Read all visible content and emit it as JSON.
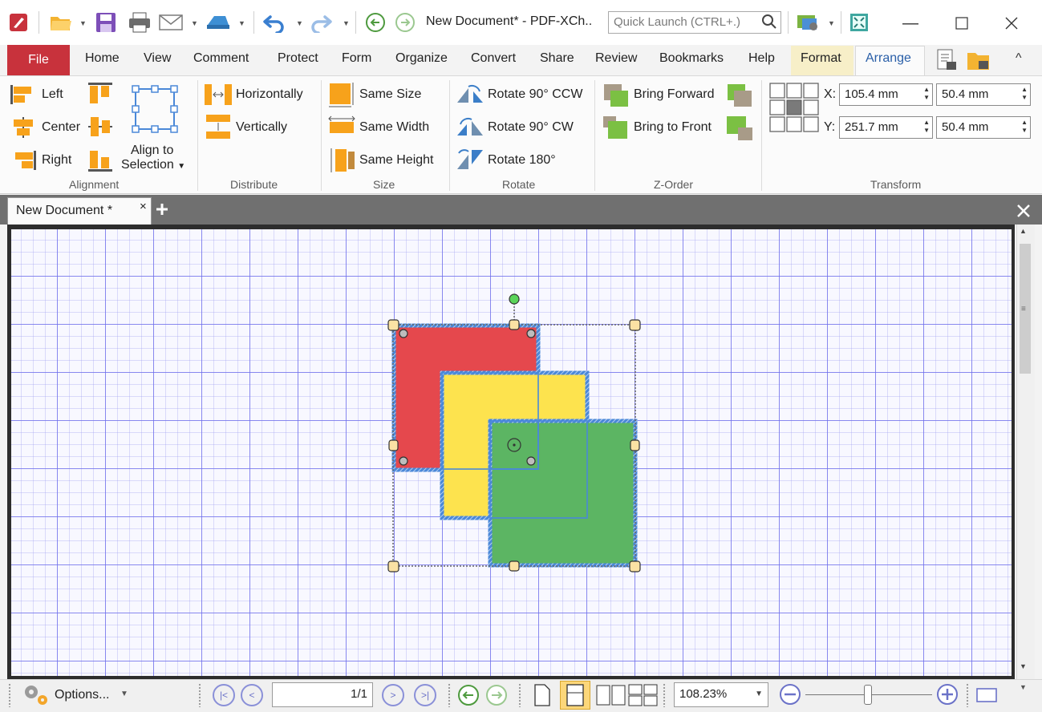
{
  "window": {
    "title": "New Document* - PDF-XCh..",
    "quick_launch_placeholder": "Quick Launch (CTRL+.)"
  },
  "menu": {
    "tabs": [
      "File",
      "Home",
      "View",
      "Comment",
      "Protect",
      "Form",
      "Organize",
      "Convert",
      "Share",
      "Review",
      "Bookmarks",
      "Help",
      "Format",
      "Arrange"
    ],
    "active_tab": "Arrange",
    "contextual_tab": "Format"
  },
  "ribbon": {
    "alignment": {
      "label": "Alignment",
      "left": "Left",
      "center": "Center",
      "right": "Right",
      "align_to_line1": "Align to",
      "align_to_line2": "Selection"
    },
    "distribute": {
      "label": "Distribute",
      "horizontally": "Horizontally",
      "vertically": "Vertically"
    },
    "size": {
      "label": "Size",
      "same_size": "Same Size",
      "same_width": "Same Width",
      "same_height": "Same Height"
    },
    "rotate": {
      "label": "Rotate",
      "ccw": "Rotate 90° CCW",
      "cw": "Rotate 90° CW",
      "r180": "Rotate 180°"
    },
    "zorder": {
      "label": "Z-Order",
      "bring_forward": "Bring Forward",
      "bring_to_front": "Bring to Front"
    },
    "transform": {
      "label": "Transform",
      "x_label": "X:",
      "x_value": "105.4 mm",
      "y_label": "Y:",
      "y_value": "251.7 mm",
      "width_value": "50.4 mm",
      "height_value": "50.4 mm"
    }
  },
  "document_tab": {
    "title": "New Document *"
  },
  "status": {
    "options_label": "Options...",
    "page_indicator": "1/1",
    "zoom_value": "108.23%"
  },
  "colors": {
    "file_tab": "#c8323c",
    "square_red": "#e5484d",
    "square_yellow": "#fde34e",
    "square_green": "#5cb563",
    "selection_blue": "#4a88d8"
  }
}
